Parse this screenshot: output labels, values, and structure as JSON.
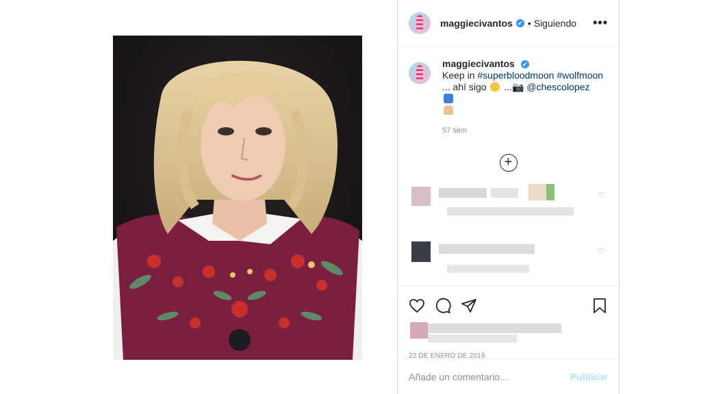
{
  "post": {
    "username": "maggiecivantos",
    "verified_badge": "✔",
    "separator": "•",
    "follow_status": "Siguiendo",
    "more_icon": "•••",
    "caption_prefix": "Keep in",
    "hashtag1": "#superbloodmoon",
    "hashtag2": "#wolfmoon",
    "caption_mid": "... ahí sigo",
    "caption_mid2": "...📷",
    "mention": "@chescolopez",
    "caption_time": "57 sem",
    "load_more": "+",
    "date": "22 DE ENERO DE 2019"
  },
  "comment_box": {
    "placeholder": "Añade un comentario...",
    "publish_label": "Publicar"
  },
  "colors": {
    "link": "#003569",
    "publish_disabled": "#b2dffc",
    "verified": "#3897f0"
  }
}
